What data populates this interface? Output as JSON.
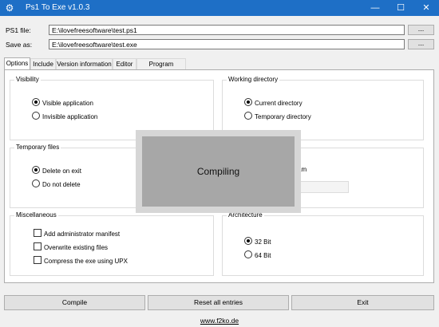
{
  "window": {
    "title": "Ps1 To Exe v1.0.3",
    "icon": "gear-icon",
    "minimize": "—",
    "maximize": "☐",
    "close": "✕"
  },
  "fields": {
    "ps1_label": "PS1 file:",
    "ps1_value": "E:\\ilovefreesoftware\\test.ps1",
    "save_label": "Save as:",
    "save_value": "E:\\ilovefreesoftware\\test.exe",
    "browse_label": "..."
  },
  "tabs": [
    "Options",
    "Include",
    "Version information",
    "Editor",
    "Program settings"
  ],
  "groups": {
    "visibility": {
      "title": "Visibility",
      "options": [
        "Visible application",
        "Invisible application"
      ],
      "selected": 0
    },
    "working_directory": {
      "title": "Working directory",
      "options": [
        "Current directory",
        "Temporary directory"
      ],
      "selected": 0
    },
    "temporary_files": {
      "title": "Temporary files",
      "options": [
        "Delete on exit",
        "Do not delete"
      ],
      "selected": 0
    },
    "partial_label": "am",
    "miscellaneous": {
      "title": "Miscellaneous",
      "options": [
        "Add administrator manifest",
        "Overwrite existing files",
        "Compress the exe using UPX"
      ]
    },
    "architecture": {
      "title": "Architecture",
      "options": [
        "32 Bit",
        "64 Bit"
      ],
      "selected": 0
    }
  },
  "overlay": {
    "text": "Compiling"
  },
  "buttons": {
    "compile": "Compile",
    "reset": "Reset all entries",
    "exit": "Exit"
  },
  "footer": {
    "link": "www.f2ko.de"
  }
}
